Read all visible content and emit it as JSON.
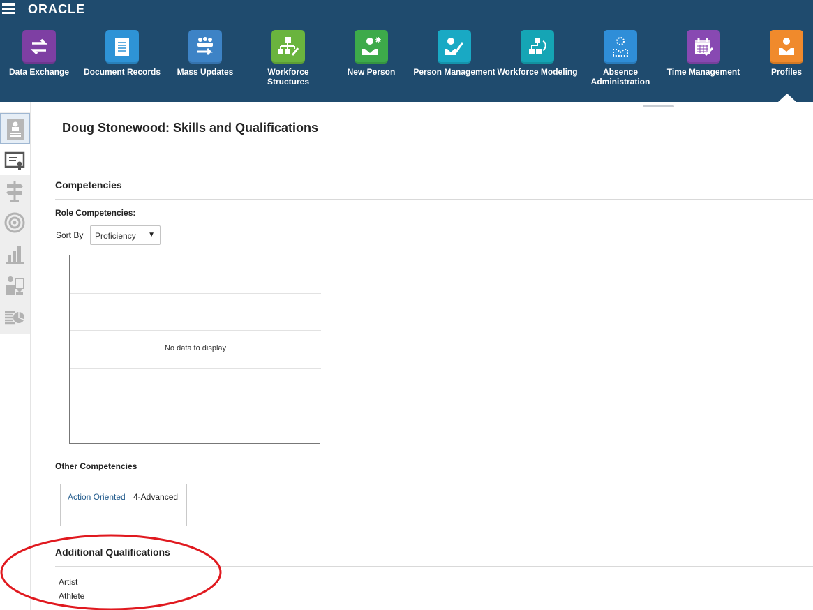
{
  "header": {
    "brand": "ORACLE",
    "nav": [
      {
        "label": "Data Exchange",
        "color": "#7e3fa3",
        "icon": "exchange-arrows-icon"
      },
      {
        "label": "Document Records",
        "color": "#2e93d6",
        "icon": "document-icon"
      },
      {
        "label": "Mass Updates",
        "color": "#3d83c6",
        "icon": "group-arrow-icon"
      },
      {
        "label": "Workforce Structures",
        "color": "#6ab43e",
        "icon": "org-chart-icon"
      },
      {
        "label": "New Person",
        "color": "#3daa4a",
        "icon": "new-person-icon"
      },
      {
        "label": "Person Management",
        "color": "#19a9c4",
        "icon": "person-edit-icon"
      },
      {
        "label": "Workforce Modeling",
        "color": "#15a5b5",
        "icon": "modeling-icon"
      },
      {
        "label": "Absence Administration",
        "color": "#2f8ed8",
        "icon": "absence-person-icon"
      },
      {
        "label": "Time Management",
        "color": "#8849b2",
        "icon": "calendar-icon"
      },
      {
        "label": "Profiles",
        "color": "#f08a2c",
        "icon": "profile-icon"
      }
    ]
  },
  "rail": {
    "items": [
      "profile-card-icon",
      "certificate-icon",
      "signpost-icon",
      "target-icon",
      "bar-chart-icon",
      "people-board-icon",
      "report-pie-icon"
    ]
  },
  "page": {
    "title": "Doug Stonewood: Skills and Qualifications",
    "competencies_heading": "Competencies",
    "role_competencies_label": "Role Competencies:",
    "sort_by_label": "Sort By",
    "sort_by_value": "Proficiency",
    "chart_empty_text": "No data to display",
    "other_competencies_label": "Other Competencies",
    "other_competencies": [
      {
        "name": "Action Oriented",
        "level": "4-Advanced"
      }
    ],
    "additional_heading": "Additional Qualifications",
    "qualifications": [
      "Artist",
      "Athlete"
    ]
  },
  "colors": {
    "header_bg": "#1f4b6e",
    "link": "#215a8c",
    "annotation": "#e0191f"
  }
}
